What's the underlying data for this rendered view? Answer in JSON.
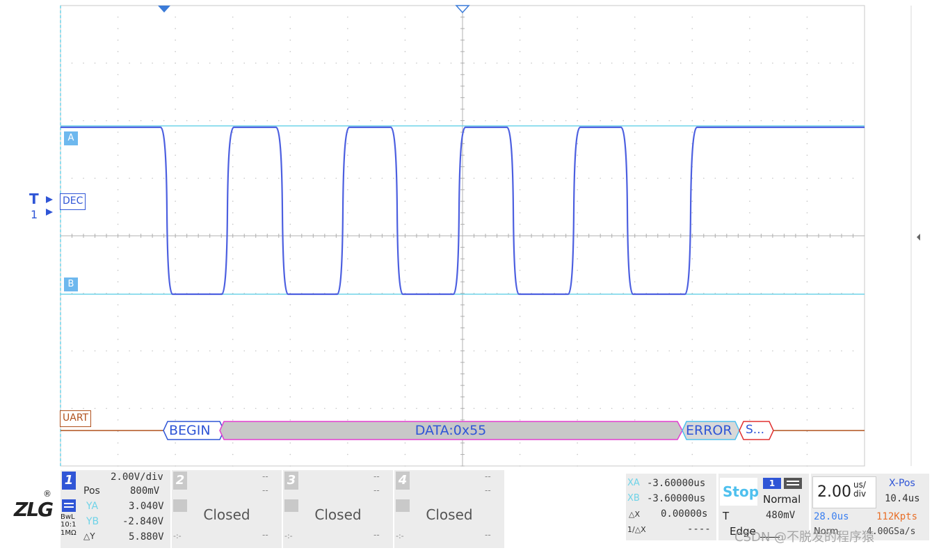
{
  "markers": {
    "trace_a": "A",
    "trace_b": "B",
    "trigger": "T",
    "channel_ref": "1",
    "dec_label": "DEC",
    "uart_label": "UART"
  },
  "decode": {
    "segments": [
      {
        "label": "BEGIN",
        "kind": "begin"
      },
      {
        "label": "DATA:0x55",
        "kind": "data"
      },
      {
        "label": "ERROR",
        "kind": "error"
      },
      {
        "label": "S...",
        "kind": "stop"
      }
    ]
  },
  "channel1": {
    "number": "1",
    "scale": "2.00V/div",
    "pos_label": "Pos",
    "pos_value": "800mV",
    "ya_label": "YA",
    "ya_value": "3.040V",
    "yb_label": "YB",
    "yb_value": "-2.840V",
    "dy_label": "△Y",
    "dy_value": "5.880V",
    "coupling": "BwL",
    "probe": "10:1",
    "impedance": "1MΩ"
  },
  "channel2": {
    "number": "2",
    "status": "Closed",
    "dash1": "--",
    "dash2": "--",
    "dash3": "--",
    "dash4": "-:-"
  },
  "channel3": {
    "number": "3",
    "status": "Closed",
    "dash1": "--",
    "dash2": "--",
    "dash3": "--",
    "dash4": "-:-"
  },
  "channel4": {
    "number": "4",
    "status": "Closed",
    "dash1": "--",
    "dash2": "--",
    "dash3": "--",
    "dash4": "-:-"
  },
  "cursors": {
    "xa_label": "XA",
    "xa_value": "-3.60000us",
    "xb_label": "XB",
    "xb_value": "-3.60000us",
    "dx_label": "△X",
    "dx_value": "0.00000s",
    "inv_label": "1/△X",
    "inv_value": "----"
  },
  "trigger": {
    "state": "Stop",
    "source": "1",
    "mode": "Normal",
    "t_label": "T",
    "level": "480mV",
    "type": "Edge"
  },
  "timebase": {
    "value": "2.00",
    "unit_top": "us/",
    "unit_bottom": "div",
    "xpos_label": "X-Pos",
    "xpos_value": "10.4us",
    "delay": "28.0us",
    "memory": "112Kpts",
    "acq_mode": "Norm",
    "sample_rate": "4.00GSa/s"
  },
  "watermark": "CSDN @不脱发的程序猿",
  "colors": {
    "trace": "#4c5fe0",
    "cursor": "#6ed3e8",
    "decode_fill": "#c8c8c8",
    "decode_border": "#e23fd0",
    "uart": "#b0501c",
    "stop": "#4ec0ee",
    "memory": "#e8702a",
    "delay": "#3a7ff0"
  }
}
